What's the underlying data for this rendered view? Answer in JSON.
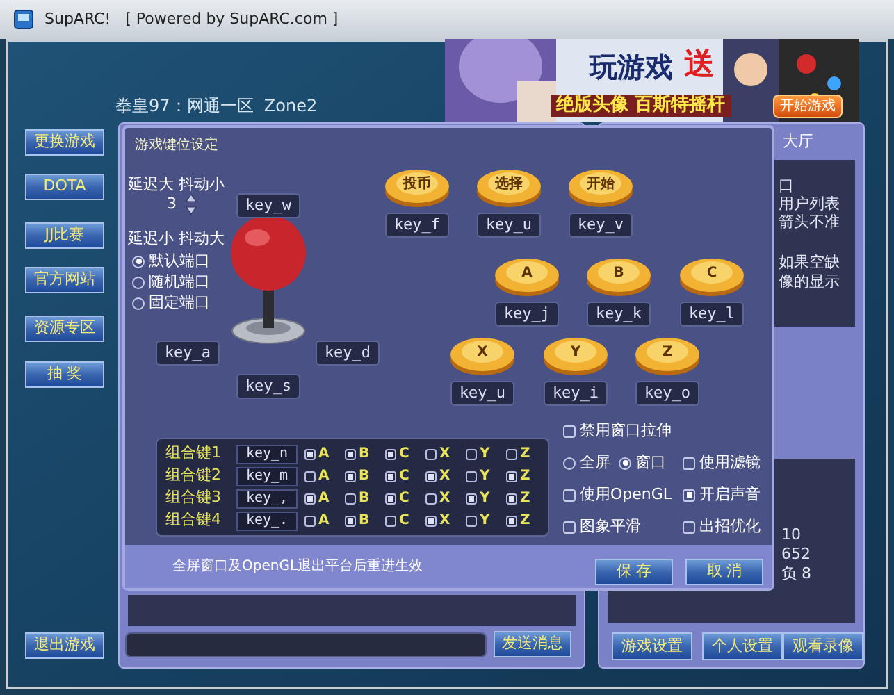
{
  "window": {
    "title": "SupARC!   [ Powered by SupARC.com ]"
  },
  "zone": "拳皇97：网通一区  Zone2",
  "banner": {
    "headline": "玩游戏",
    "gift": "送",
    "caption": "绝版头像 百斯特摇杆",
    "button": "开始游戏"
  },
  "sidebar": [
    {
      "label": "更换游戏"
    },
    {
      "label": "DOTA"
    },
    {
      "label": "JJ比赛"
    },
    {
      "label": "官方网站"
    },
    {
      "label": "资源专区"
    },
    {
      "label": "抽 奖"
    }
  ],
  "exit_button": "退出游戏",
  "dialog": {
    "title": "游戏键位设定",
    "latency_high": "延迟大 抖动小",
    "port_value": "3",
    "latency_low": "延迟小 抖动大",
    "ports": [
      {
        "label": "默认端口",
        "selected": true
      },
      {
        "label": "随机端口",
        "selected": false
      },
      {
        "label": "固定端口",
        "selected": false
      }
    ],
    "direction_keys": {
      "up": "key_w",
      "left": "key_a",
      "right": "key_d",
      "down": "key_s"
    },
    "buttons": [
      {
        "label": "投币",
        "key": "key_f"
      },
      {
        "label": "选择",
        "key": "key_u"
      },
      {
        "label": "开始",
        "key": "key_v"
      },
      {
        "label": "A",
        "key": "key_j"
      },
      {
        "label": "B",
        "key": "key_k"
      },
      {
        "label": "C",
        "key": "key_l"
      },
      {
        "label": "X",
        "key": "key_u"
      },
      {
        "label": "Y",
        "key": "key_i"
      },
      {
        "label": "Z",
        "key": "key_o"
      }
    ],
    "combos": [
      {
        "label": "组合键1",
        "key": "key_n",
        "buttons": [
          {
            "label": "A",
            "checked": true
          },
          {
            "label": "B",
            "checked": true
          },
          {
            "label": "C",
            "checked": true
          },
          {
            "label": "X",
            "checked": false
          },
          {
            "label": "Y",
            "checked": false
          },
          {
            "label": "Z",
            "checked": false
          }
        ]
      },
      {
        "label": "组合键2",
        "key": "key_m",
        "buttons": [
          {
            "label": "A",
            "checked": false
          },
          {
            "label": "B",
            "checked": true
          },
          {
            "label": "C",
            "checked": true
          },
          {
            "label": "X",
            "checked": true
          },
          {
            "label": "Y",
            "checked": false
          },
          {
            "label": "Z",
            "checked": true
          }
        ]
      },
      {
        "label": "组合键3",
        "key": "key_,",
        "buttons": [
          {
            "label": "A",
            "checked": true
          },
          {
            "label": "B",
            "checked": false
          },
          {
            "label": "C",
            "checked": true
          },
          {
            "label": "X",
            "checked": false
          },
          {
            "label": "Y",
            "checked": true
          },
          {
            "label": "Z",
            "checked": true
          }
        ]
      },
      {
        "label": "组合键4",
        "key": "key_.",
        "buttons": [
          {
            "label": "A",
            "checked": false
          },
          {
            "label": "B",
            "checked": true
          },
          {
            "label": "C",
            "checked": false
          },
          {
            "label": "X",
            "checked": true
          },
          {
            "label": "Y",
            "checked": false
          },
          {
            "label": "Z",
            "checked": true
          }
        ]
      }
    ],
    "option_rows": [
      [
        {
          "kind": "checkbox",
          "label": "禁用窗口拉伸",
          "checked": false
        }
      ],
      [
        {
          "kind": "radio",
          "label": "全屏",
          "selected": false
        },
        {
          "kind": "radio",
          "label": "窗口",
          "selected": true
        },
        {
          "kind": "checkbox",
          "label": "使用滤镜",
          "checked": false
        }
      ],
      [
        {
          "kind": "checkbox",
          "label": "使用OpenGL",
          "checked": false
        },
        {
          "kind": "checkbox",
          "label": "开启声音",
          "checked": true
        }
      ],
      [
        {
          "kind": "checkbox",
          "label": "图象平滑",
          "checked": false
        },
        {
          "kind": "checkbox",
          "label": "出招优化",
          "checked": false
        }
      ]
    ],
    "note": "全屏窗口及OpenGL退出平台后重进生效",
    "save": "保 存",
    "cancel": "取 消"
  },
  "lobby": {
    "tab": "大厅",
    "fragments": [
      "口",
      "用户列表",
      "箭头不准",
      "如果空缺",
      "像的显示"
    ],
    "stats": [
      "10",
      "652",
      "负 8"
    ]
  },
  "chat": {
    "send": "发送消息"
  },
  "footer_buttons": [
    "游戏设置",
    "个人设置",
    "观看录像"
  ]
}
